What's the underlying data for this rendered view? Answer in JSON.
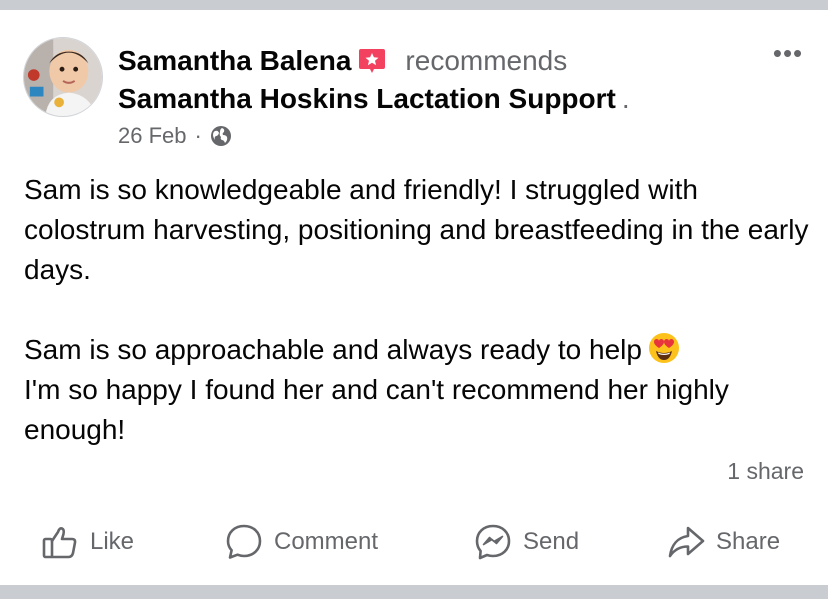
{
  "post": {
    "author": "Samantha Balena",
    "verb": "recommends",
    "page_name": "Samantha Hoskins Lactation Support",
    "page_suffix": ".",
    "date": "26 Feb",
    "meta_separator": "·",
    "privacy_icon": "globe-icon",
    "badge_icon": "recommendation-badge-icon",
    "more_label": "•••",
    "body": {
      "paragraph1": "Sam is so knowledgeable and friendly! I struggled with colostrum harvesting, positioning and breastfeeding in the early days.",
      "paragraph2_line1": "Sam is so approachable and always ready to help",
      "paragraph2_emoji": "heart-eyes-emoji",
      "paragraph2_rest": "I'm so happy I found her and can't recommend her highly enough!"
    },
    "share_count": "1 share"
  },
  "actions": {
    "like": "Like",
    "comment": "Comment",
    "send": "Send",
    "share": "Share"
  },
  "colors": {
    "text_primary": "#050505",
    "text_secondary": "#65676b",
    "badge_red": "#f3425f",
    "separator_grey": "#c9ccd1"
  }
}
